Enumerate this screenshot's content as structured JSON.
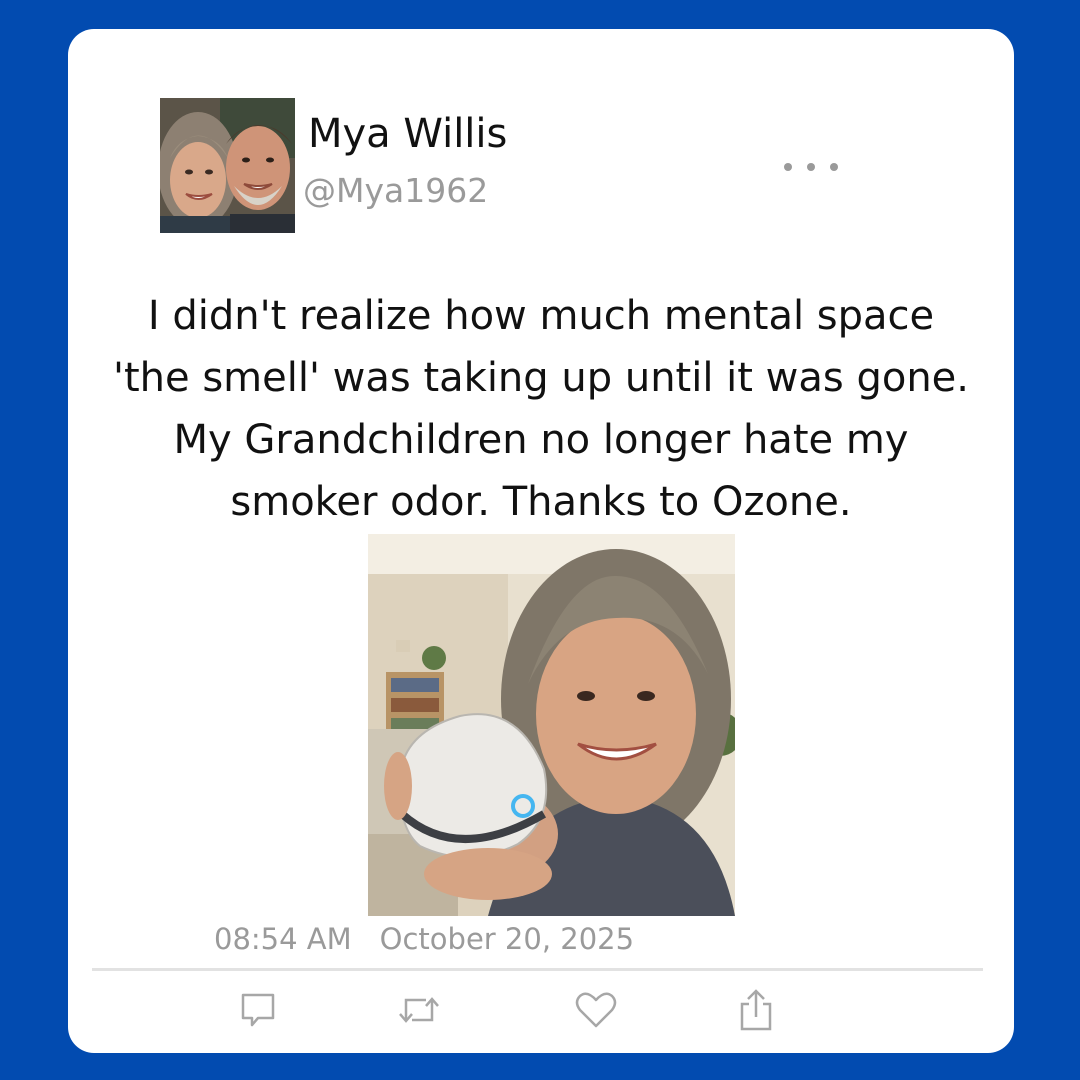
{
  "author": {
    "name": "Mya Willis",
    "handle": "@Mya1962",
    "avatar_icon": "couple-avatar-photo"
  },
  "tweet": {
    "lines": [
      "I didn't realize how much mental space",
      "'the smell' was taking up until it was gone.",
      "My Grandchildren no longer hate my",
      "smoker odor. Thanks to Ozone."
    ],
    "photo_icon": "woman-holding-ozone-device-photo"
  },
  "meta": {
    "time": "08:54 AM",
    "date": "October 20, 2025"
  },
  "actions": {
    "icons": [
      "reply-icon",
      "retweet-icon",
      "like-icon",
      "share-icon"
    ]
  },
  "colors": {
    "background": "#024bb0",
    "card": "#ffffff",
    "text": "#111111",
    "muted": "#9a9a9a",
    "divider": "#e2e2e2"
  }
}
